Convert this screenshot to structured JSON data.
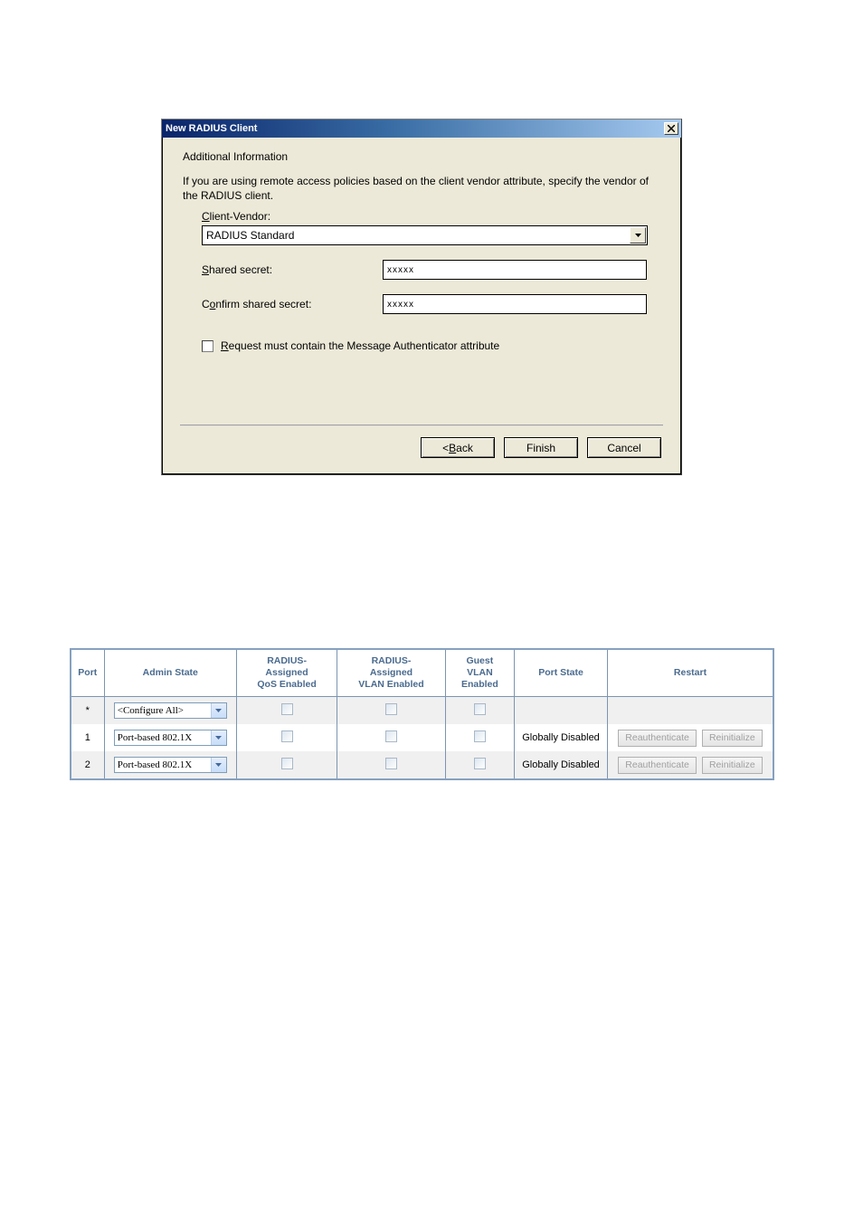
{
  "dialog": {
    "title": "New RADIUS Client",
    "section": "Additional Information",
    "description": "If you are using remote access policies based on the client vendor attribute, specify the vendor of the RADIUS client.",
    "client_vendor_label_pre": "C",
    "client_vendor_label_post": "lient-Vendor:",
    "client_vendor_value": "RADIUS Standard",
    "shared_secret_label_pre": "S",
    "shared_secret_label_post": "hared secret:",
    "shared_secret_value": "xxxxx",
    "confirm_label_pre": "C",
    "confirm_label_mid": "o",
    "confirm_label_post": "nfirm shared secret:",
    "confirm_value": "xxxxx",
    "request_label_pre": "R",
    "request_label_post": "equest must contain the Message Authenticator attribute",
    "back_pre": "< ",
    "back_u": "B",
    "back_post": "ack",
    "finish": "Finish",
    "cancel": "Cancel"
  },
  "table": {
    "headers": {
      "port": "Port",
      "admin": "Admin State",
      "qos": "RADIUS-\nAssigned\nQoS Enabled",
      "vlan": "RADIUS-\nAssigned\nVLAN Enabled",
      "guest": "Guest\nVLAN\nEnabled",
      "state": "Port State",
      "restart": "Restart"
    },
    "rows": [
      {
        "port": "*",
        "admin": "<Configure All>",
        "state": "",
        "reauth": "",
        "reinit": ""
      },
      {
        "port": "1",
        "admin": "Port-based 802.1X",
        "state": "Globally Disabled",
        "reauth": "Reauthenticate",
        "reinit": "Reinitialize"
      },
      {
        "port": "2",
        "admin": "Port-based 802.1X",
        "state": "Globally Disabled",
        "reauth": "Reauthenticate",
        "reinit": "Reinitialize"
      }
    ]
  }
}
